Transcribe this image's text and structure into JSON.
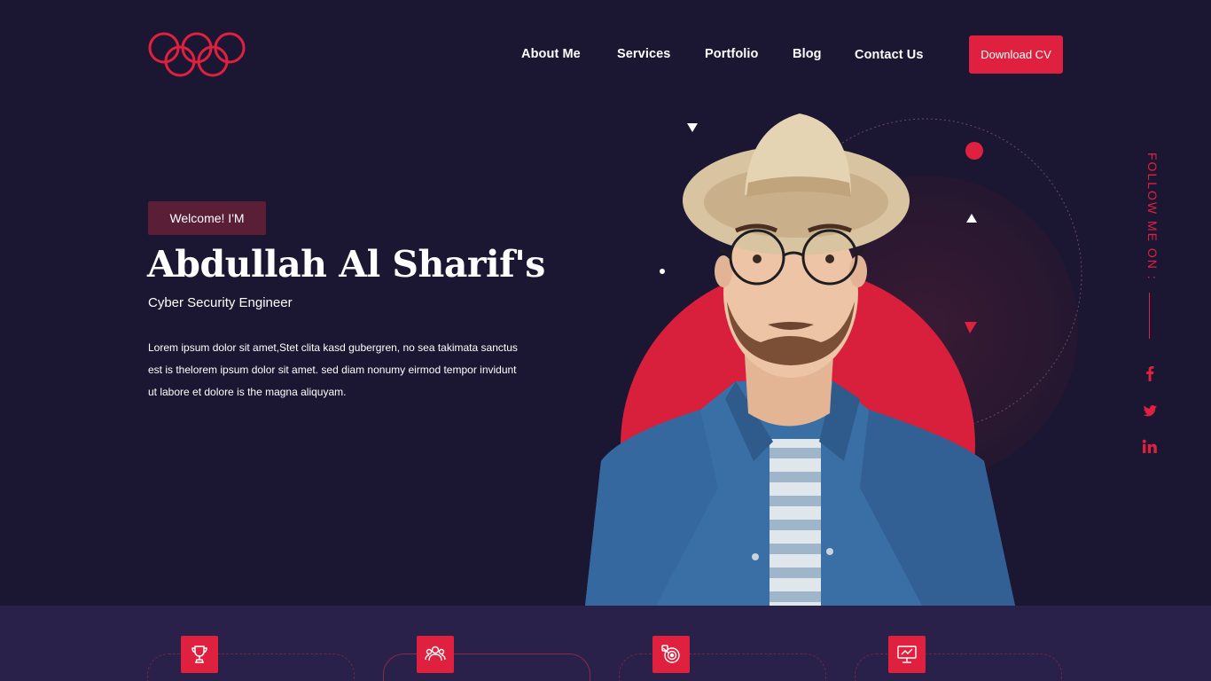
{
  "nav": {
    "items": [
      "About Me",
      "Services",
      "Portfolio",
      "Blog",
      "Contact Us"
    ],
    "cta_label": "Download CV"
  },
  "hero": {
    "welcome": "Welcome! I'M",
    "name": "Abdullah Al Sharif's",
    "role": "Cyber Security Engineer",
    "description": "Lorem ipsum dolor sit amet,Stet clita kasd gubergren, no sea takimata sanctus est is thelorem ipsum dolor sit amet. sed diam nonumy eirmod tempor invidunt ut labore et dolore is the magna aliquyam."
  },
  "social": {
    "label": "FOLLOW ME ON :",
    "icons": [
      "facebook-icon",
      "twitter-icon",
      "linkedin-icon"
    ]
  },
  "features": {
    "icons": [
      "trophy-icon",
      "team-icon",
      "target-icon",
      "presentation-icon"
    ]
  },
  "colors": {
    "background": "#1b1632",
    "accent": "#e0203f",
    "welcome_bg": "#5a1e36",
    "bottom_band": "#29214a"
  }
}
